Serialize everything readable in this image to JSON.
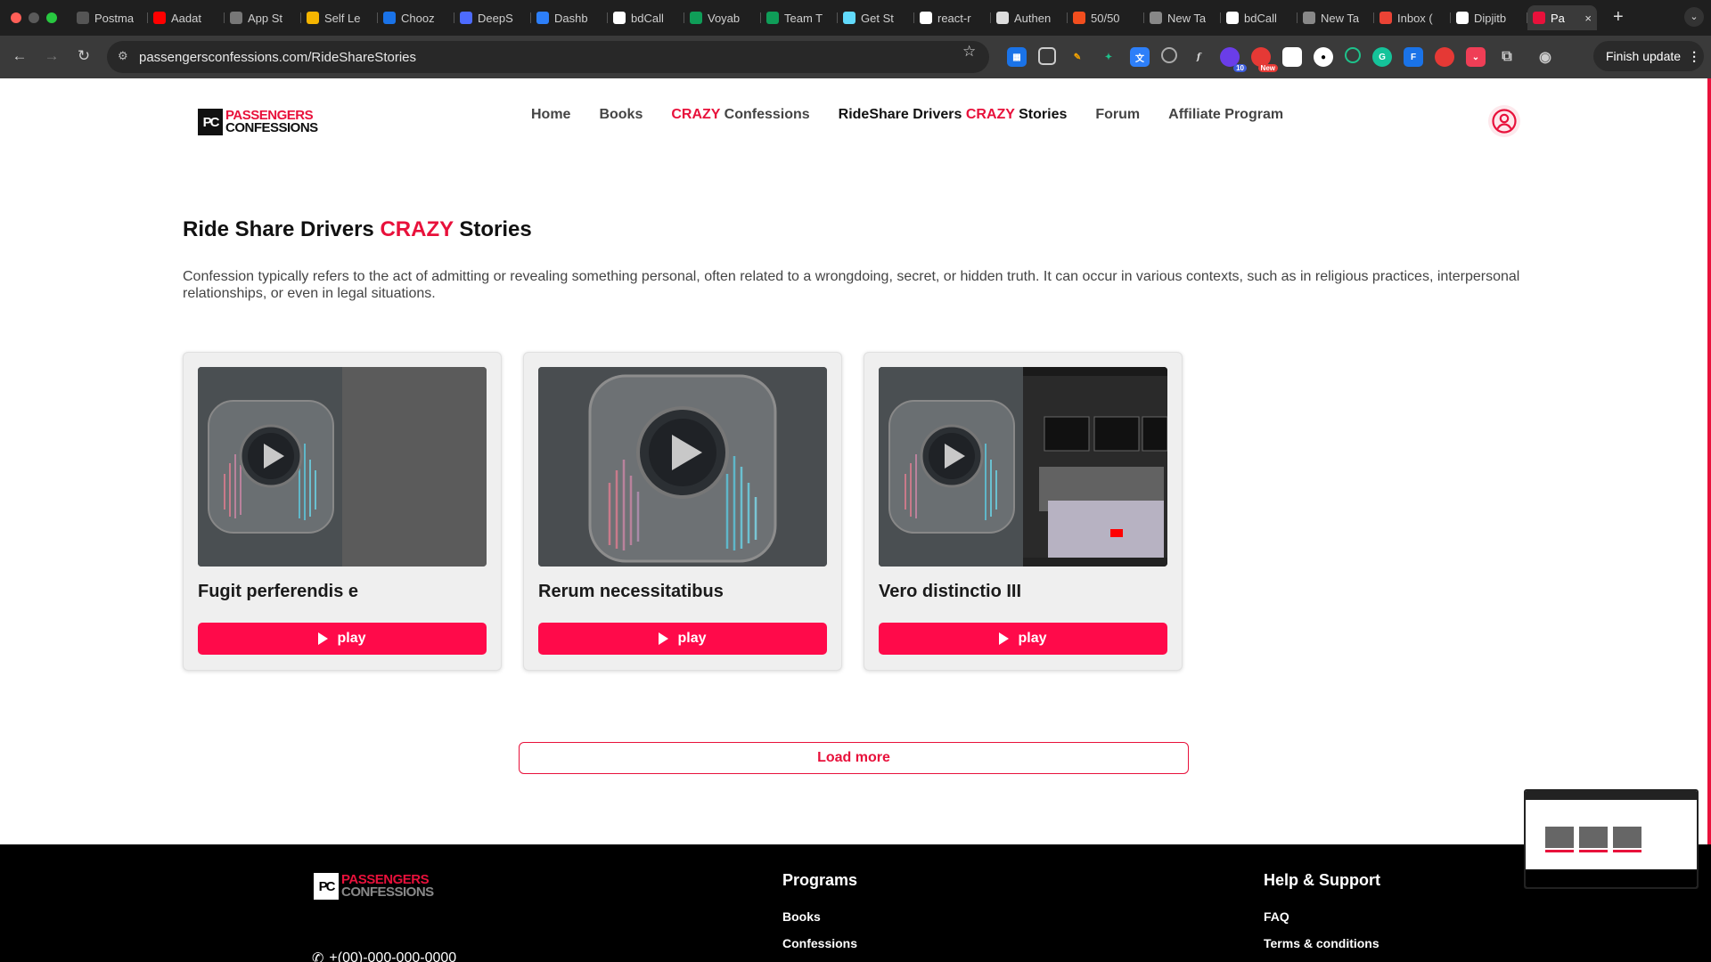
{
  "browser": {
    "tabs": [
      {
        "label": "Postma",
        "icon": "postman-icon",
        "color": "#555"
      },
      {
        "label": "Aadat",
        "icon": "youtube-icon",
        "color": "#ff0000"
      },
      {
        "label": "App St",
        "icon": "apple-icon",
        "color": "#777"
      },
      {
        "label": "Self Le",
        "icon": "sheets-icon",
        "color": "#f4b400"
      },
      {
        "label": "Chooz",
        "icon": "drive-icon",
        "color": "#1a73e8"
      },
      {
        "label": "DeepS",
        "icon": "deepseek-icon",
        "color": "#4d6bfe"
      },
      {
        "label": "Dashb",
        "icon": "dashboard-icon",
        "color": "#2d7ff9"
      },
      {
        "label": "bdCall",
        "icon": "github-icon",
        "color": "#fff"
      },
      {
        "label": "Voyab",
        "icon": "drive-icon",
        "color": "#0f9d58"
      },
      {
        "label": "Team T",
        "icon": "sheets-icon",
        "color": "#0f9d58"
      },
      {
        "label": "Get St",
        "icon": "react-icon",
        "color": "#61dafb"
      },
      {
        "label": "react-r",
        "icon": "github-icon",
        "color": "#fff"
      },
      {
        "label": "Authen",
        "icon": "openai-icon",
        "color": "#ddd"
      },
      {
        "label": "50/50",
        "icon": "figma-icon",
        "color": "#f24e1e"
      },
      {
        "label": "New Ta",
        "icon": "chrome-icon",
        "color": "#888"
      },
      {
        "label": "bdCall",
        "icon": "github-icon",
        "color": "#fff"
      },
      {
        "label": "New Ta",
        "icon": "chrome-icon",
        "color": "#888"
      },
      {
        "label": "Inbox (",
        "icon": "gmail-icon",
        "color": "#ea4335"
      },
      {
        "label": "Dipjitb",
        "icon": "github-icon",
        "color": "#fff"
      },
      {
        "label": "Pa",
        "icon": "site-icon",
        "color": "#e8113b",
        "active": true
      }
    ],
    "new_tab": "+",
    "url_host": "passengersconfessions.com",
    "url_path": "/RideShareStories",
    "finish_update": "Finish update",
    "ext_badges": {
      "b1": "10",
      "b2": "New"
    }
  },
  "site": {
    "logo": {
      "mark": "PC",
      "line1": "PASSENGERS",
      "line2": "CONFESSIONS"
    },
    "nav": {
      "home": "Home",
      "books": "Books",
      "crazy_word": "CRAZY",
      "confessions": "Confessions",
      "rideshare_pre": "RideShare Drivers",
      "rideshare_crazy": "CRAZY",
      "rideshare_post": "Stories",
      "forum": "Forum",
      "affiliate": "Affiliate Program"
    },
    "page_title": {
      "pre": "Ride Share Drivers",
      "crazy": "CRAZY",
      "post": "Stories"
    },
    "description": "Confession typically refers to the act of admitting or revealing something personal, often related to a wrongdoing, secret, or hidden truth. It can occur in various contexts, such as in religious practices, interpersonal relationships, or even in legal situations.",
    "cards": [
      {
        "title": "Fugit perferendis e",
        "play": "play"
      },
      {
        "title": "Rerum necessitatibus",
        "play": "play"
      },
      {
        "title": "Vero distinctio III",
        "play": "play"
      }
    ],
    "load_more": "Load more",
    "footer": {
      "phone": "+(00)-000-000-0000",
      "programs_title": "Programs",
      "programs": [
        "Books",
        "Confessions"
      ],
      "help_title": "Help & Support",
      "help": [
        "FAQ",
        "Terms & conditions"
      ]
    },
    "accent": "#e8113b",
    "button_color": "#ff0a4a"
  }
}
